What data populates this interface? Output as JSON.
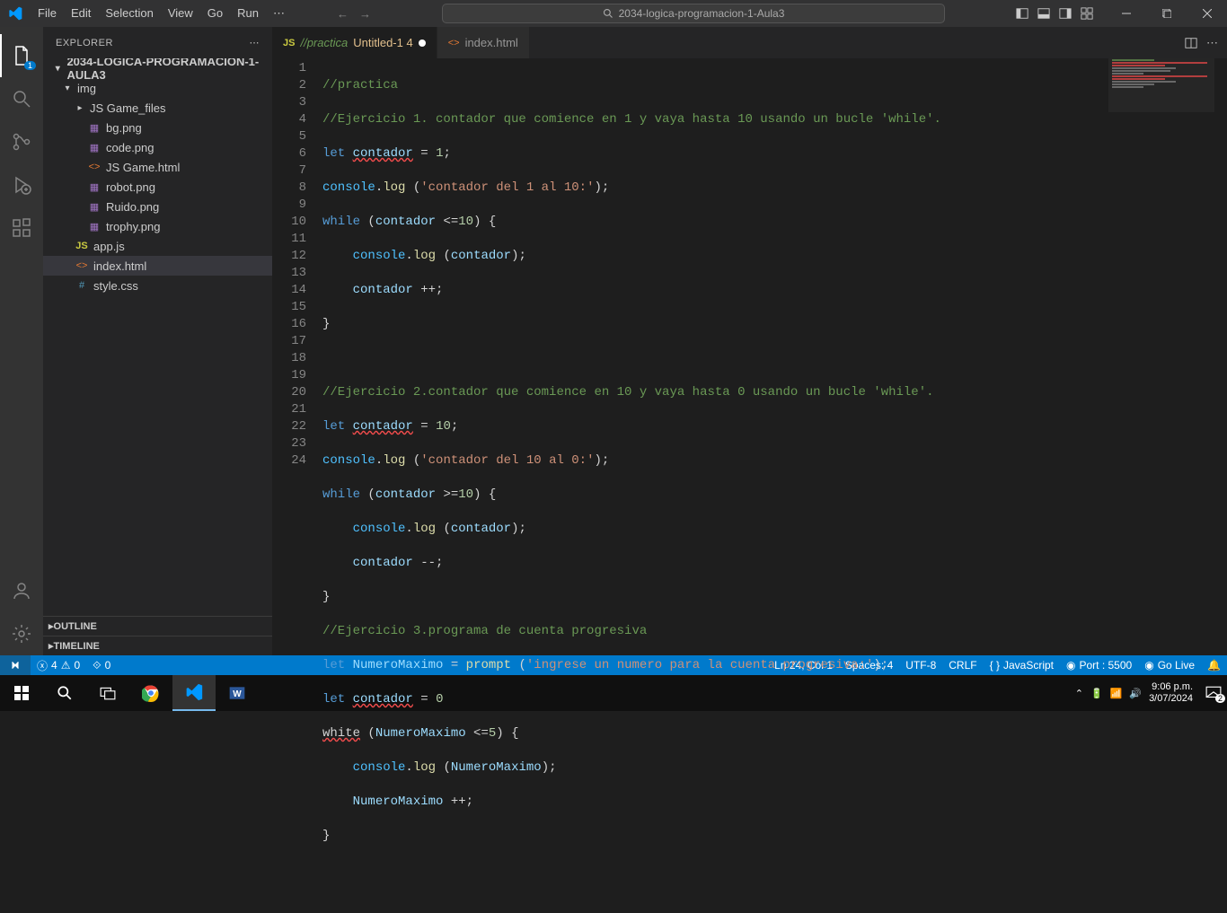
{
  "titlebar": {
    "menus": [
      "File",
      "Edit",
      "Selection",
      "View",
      "Go",
      "Run"
    ],
    "search": "2034-logica-programacion-1-Aula3"
  },
  "sidebar": {
    "header": "EXPLORER",
    "root": "2034-LOGICA-PROGRAMACION-1-AULA3",
    "folders": {
      "img": "img",
      "jsgame": "JS Game_files"
    },
    "files": {
      "bg": "bg.png",
      "code": "code.png",
      "jsgamehtml": "JS Game.html",
      "robot": "robot.png",
      "ruido": "Ruido.png",
      "trophy": "trophy.png",
      "appjs": "app.js",
      "indexhtml": "index.html",
      "stylecss": "style.css"
    },
    "outline": "OUTLINE",
    "timeline": "TIMELINE"
  },
  "tabs": {
    "practica": "//practica",
    "practica_suffix": "Untitled-1 4",
    "index": "index.html"
  },
  "code": {
    "l1": "//practica",
    "l2": "//Ejercicio 1. contador que comience en 1 y vaya hasta 10 usando un bucle 'while'.",
    "l3_let": "let",
    "l3_var": "contador",
    "l3_eq": " = ",
    "l3_num": "1",
    "l3_semi": ";",
    "l4_obj": "console",
    "l4_dot": ".",
    "l4_fn": "log",
    "l4_open": " (",
    "l4_str": "'contador del 1 al 10:'",
    "l4_close": ");",
    "l5_while": "while",
    "l5_open": " (",
    "l5_var": "contador",
    "l5_op": " <=",
    "l5_num": "10",
    "l5_close": ") {",
    "l6_indent": "    ",
    "l6_obj": "console",
    "l6_dot": ".",
    "l6_fn": "log",
    "l6_open": " (",
    "l6_var": "contador",
    "l6_close": ");",
    "l7_indent": "    ",
    "l7_var": "contador",
    "l7_op": " ++;",
    "l8": "}",
    "l10": "//Ejercicio 2.contador que comience en 10 y vaya hasta 0 usando un bucle 'while'.",
    "l11_let": "let",
    "l11_var": "contador",
    "l11_eq": " = ",
    "l11_num": "10",
    "l11_semi": ";",
    "l12_obj": "console",
    "l12_dot": ".",
    "l12_fn": "log",
    "l12_open": " (",
    "l12_str": "'contador del 10 al 0:'",
    "l12_close": ");",
    "l13_while": "while",
    "l13_open": " (",
    "l13_var": "contador",
    "l13_op": " >=",
    "l13_num": "10",
    "l13_close": ") {",
    "l14_indent": "    ",
    "l14_obj": "console",
    "l14_dot": ".",
    "l14_fn": "log",
    "l14_open": " (",
    "l14_var": "contador",
    "l14_close": ");",
    "l15_indent": "    ",
    "l15_var": "contador",
    "l15_op": " --;",
    "l16": "}",
    "l17": "//Ejercicio 3.programa de cuenta progresiva",
    "l18_let": "let",
    "l18_var": "NumeroMaximo",
    "l18_eq": " = ",
    "l18_fn": "prompt",
    "l18_open": " (",
    "l18_str": "'ingrese un numero para la cuenta progresiva:'",
    "l18_close": ");",
    "l19_let": "let",
    "l19_var": "contador",
    "l19_eq": " = ",
    "l19_num": "0",
    "l20_white": "white",
    "l20_open": " (",
    "l20_var": "NumeroMaximo",
    "l20_op": " <=",
    "l20_num": "5",
    "l20_close": ") {",
    "l21_indent": "    ",
    "l21_obj": "console",
    "l21_dot": ".",
    "l21_fn": "log",
    "l21_open": " (",
    "l21_var": "NumeroMaximo",
    "l21_close": ");",
    "l22_indent": "    ",
    "l22_var": "NumeroMaximo",
    "l22_op": " ++;",
    "l23": "}"
  },
  "lines": [
    "1",
    "2",
    "3",
    "4",
    "5",
    "6",
    "7",
    "8",
    "9",
    "10",
    "11",
    "12",
    "13",
    "14",
    "15",
    "16",
    "17",
    "18",
    "19",
    "20",
    "21",
    "22",
    "23",
    "24"
  ],
  "statusbar": {
    "errors": "4",
    "warnings": "0",
    "ports": "0",
    "position": "Ln 24, Col 1",
    "spaces": "Spaces: 4",
    "encoding": "UTF-8",
    "eol": "CRLF",
    "lang": "JavaScript",
    "port": "Port : 5500",
    "golive": "Go Live"
  },
  "taskbar": {
    "time": "9:06 p.m.",
    "date": "3/07/2024",
    "notif": "2"
  }
}
